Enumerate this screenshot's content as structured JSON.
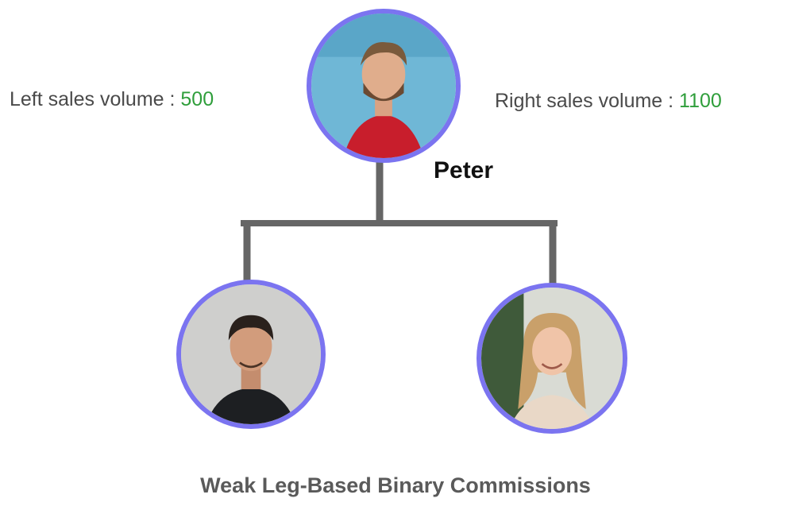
{
  "left_volume": {
    "label": "Left sales volume : ",
    "value": "500"
  },
  "right_volume": {
    "label": "Right sales volume : ",
    "value": "1100"
  },
  "root": {
    "name": "Peter"
  },
  "caption": "Weak Leg-Based Binary Commissions",
  "colors": {
    "node_border": "#7b74f0",
    "volume_value": "#2f9e3b",
    "connector": "#666666"
  }
}
